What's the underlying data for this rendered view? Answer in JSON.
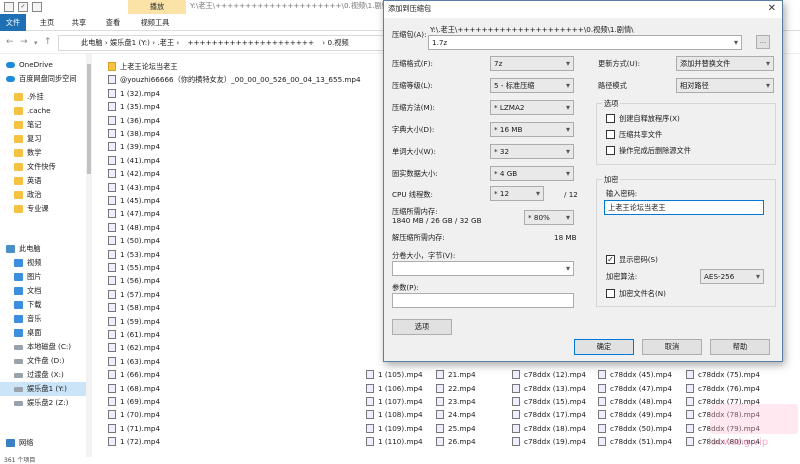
{
  "titlebar": {
    "play_tab": "播放",
    "window_title": "Y:\\老王\\+++++++++++++++++++++\\0.视频\\1.剧情\\"
  },
  "ribbon": {
    "tabs": [
      "文件",
      "主页",
      "共享",
      "查看",
      "视频工具"
    ]
  },
  "address": {
    "crumbs": [
      "此电脑",
      "娱乐盘1 (Y:)",
      ".老王",
      "+++++++++++++++++++++",
      "0.视频"
    ]
  },
  "nav": {
    "items": [
      {
        "label": "OneDrive",
        "icon": "cloud"
      },
      {
        "label": "百度网盘同步空间",
        "icon": "cloud"
      },
      {
        "label": ".外挂",
        "icon": "folder"
      },
      {
        "label": ".cache",
        "icon": "folder"
      },
      {
        "label": "笔记",
        "icon": "folder"
      },
      {
        "label": "复习",
        "icon": "folder"
      },
      {
        "label": "数学",
        "icon": "folder"
      },
      {
        "label": "文件快传",
        "icon": "folder"
      },
      {
        "label": "英语",
        "icon": "folder"
      },
      {
        "label": "政治",
        "icon": "folder"
      },
      {
        "label": "专业课",
        "icon": "folder"
      },
      {
        "label": "此电脑",
        "icon": "pc"
      },
      {
        "label": "视频",
        "icon": "blue"
      },
      {
        "label": "图片",
        "icon": "blue"
      },
      {
        "label": "文档",
        "icon": "blue"
      },
      {
        "label": "下载",
        "icon": "blue"
      },
      {
        "label": "音乐",
        "icon": "blue"
      },
      {
        "label": "桌面",
        "icon": "blue"
      },
      {
        "label": "本地磁盘 (C:)",
        "icon": "drive"
      },
      {
        "label": "文件盘 (D:)",
        "icon": "drive"
      },
      {
        "label": "过渡盘 (X:)",
        "icon": "drive"
      },
      {
        "label": "娱乐盘1 (Y:)",
        "icon": "drive",
        "selected": true
      },
      {
        "label": "娱乐盘2 (Z:)",
        "icon": "drive"
      },
      {
        "label": "网络",
        "icon": "net"
      }
    ]
  },
  "files": {
    "col1": [
      {
        "name": "上老王论坛当老王",
        "type": "folder"
      },
      {
        "name": "@youzhi66666（你的横特女友）_00_00_00_526_00_04_13_655.mp4",
        "type": "mp4"
      },
      {
        "name": "1 (32).mp4",
        "type": "mp4"
      },
      {
        "name": "1 (35).mp4",
        "type": "mp4"
      },
      {
        "name": "1 (36).mp4",
        "type": "mp4"
      },
      {
        "name": "1 (38).mp4",
        "type": "mp4"
      },
      {
        "name": "1 (39).mp4",
        "type": "mp4"
      },
      {
        "name": "1 (41).mp4",
        "type": "mp4"
      },
      {
        "name": "1 (42).mp4",
        "type": "mp4"
      },
      {
        "name": "1 (43).mp4",
        "type": "mp4"
      },
      {
        "name": "1 (45).mp4",
        "type": "mp4"
      },
      {
        "name": "1 (47).mp4",
        "type": "mp4"
      },
      {
        "name": "1 (48).mp4",
        "type": "mp4"
      },
      {
        "name": "1 (50).mp4",
        "type": "mp4"
      },
      {
        "name": "1 (53).mp4",
        "type": "mp4"
      },
      {
        "name": "1 (55).mp4",
        "type": "mp4"
      },
      {
        "name": "1 (56).mp4",
        "type": "mp4"
      },
      {
        "name": "1 (57).mp4",
        "type": "mp4"
      },
      {
        "name": "1 (58).mp4",
        "type": "mp4"
      },
      {
        "name": "1 (59).mp4",
        "type": "mp4"
      },
      {
        "name": "1 (61).mp4",
        "type": "mp4"
      },
      {
        "name": "1 (62).mp4",
        "type": "mp4"
      },
      {
        "name": "1 (63).mp4",
        "type": "mp4"
      },
      {
        "name": "1 (66).mp4",
        "type": "mp4"
      },
      {
        "name": "1 (68).mp4",
        "type": "mp4"
      },
      {
        "name": "1 (69).mp4",
        "type": "mp4"
      },
      {
        "name": "1 (70).mp4",
        "type": "mp4"
      },
      {
        "name": "1 (71).mp4",
        "type": "mp4"
      },
      {
        "name": "1 (72).mp4",
        "type": "mp4"
      }
    ],
    "col2": [
      "1 (105).mp4",
      "1 (106).mp4",
      "1 (107).mp4",
      "1 (108).mp4",
      "1 (109).mp4",
      "1 (110).mp4"
    ],
    "col3": [
      "21.mp4",
      "22.mp4",
      "23.mp4",
      "24.mp4",
      "25.mp4",
      "26.mp4"
    ],
    "col4": [
      "c78ddx (12).mp4",
      "c78ddx (13).mp4",
      "c78ddx (15).mp4",
      "c78ddx (17).mp4",
      "c78ddx (18).mp4",
      "c78ddx (19).mp4"
    ],
    "col5": [
      "c78ddx (45).mp4",
      "c78ddx (47).mp4",
      "c78ddx (48).mp4",
      "c78ddx (49).mp4",
      "c78ddx (50).mp4",
      "c78ddx (51).mp4"
    ],
    "col6": [
      "c78ddx (75).mp4",
      "c78ddx (76).mp4",
      "c78ddx (77).mp4",
      "c78ddx (78).mp4",
      "c78ddx (79).mp4",
      "c78ddx (80).mp4"
    ]
  },
  "status": "361 个项目",
  "dialog": {
    "title": "添加到压缩包",
    "close": "✕",
    "archive_label": "压缩包(A):",
    "archive_path": "Y:\\.老王\\+++++++++++++++++++++\\0.视频\\1.剧情\\",
    "archive_name": "1.7z",
    "browse": "...",
    "format_label": "压缩格式(F):",
    "format_value": "7z",
    "level_label": "压缩等级(L):",
    "level_value": "5 - 标准压缩",
    "method_label": "压缩方法(M):",
    "method_value": "* LZMA2",
    "dict_label": "字典大小(D):",
    "dict_value": "* 16 MB",
    "word_label": "单词大小(W):",
    "word_value": "* 32",
    "solid_label": "固实数据大小:",
    "solid_value": "* 4 GB",
    "cpu_label": "CPU 线程数:",
    "cpu_value": "* 12",
    "cpu_total": "/ 12",
    "mem_label": "压缩所需内存:",
    "mem_detail": "1840 MB / 26 GB / 32 GB",
    "mem_value": "* 80%",
    "unmem_label": "解压缩所需内存:",
    "unmem_value": "18 MB",
    "split_label": "分卷大小，字节(V):",
    "params_label": "参数(P):",
    "options_button": "选项",
    "update_label": "更新方式(U):",
    "update_value": "添加并替换文件",
    "pathmode_label": "路径模式",
    "pathmode_value": "相对路径",
    "options_group": "选项",
    "opt_sfx": "创建自释放程序(X)",
    "opt_shared": "压缩共享文件",
    "opt_delete": "操作完成后删除源文件",
    "enc_group": "加密",
    "pwd_label": "输入密码:",
    "pwd_value": "上老王论坛当老王",
    "show_pwd": "显示密码(S)",
    "enc_method_label": "加密算法:",
    "enc_method_value": "AES-256",
    "enc_names": "加密文件名(N)",
    "ok": "确定",
    "cancel": "取消",
    "help": "帮助"
  },
  "watermark": "laowang.vip"
}
